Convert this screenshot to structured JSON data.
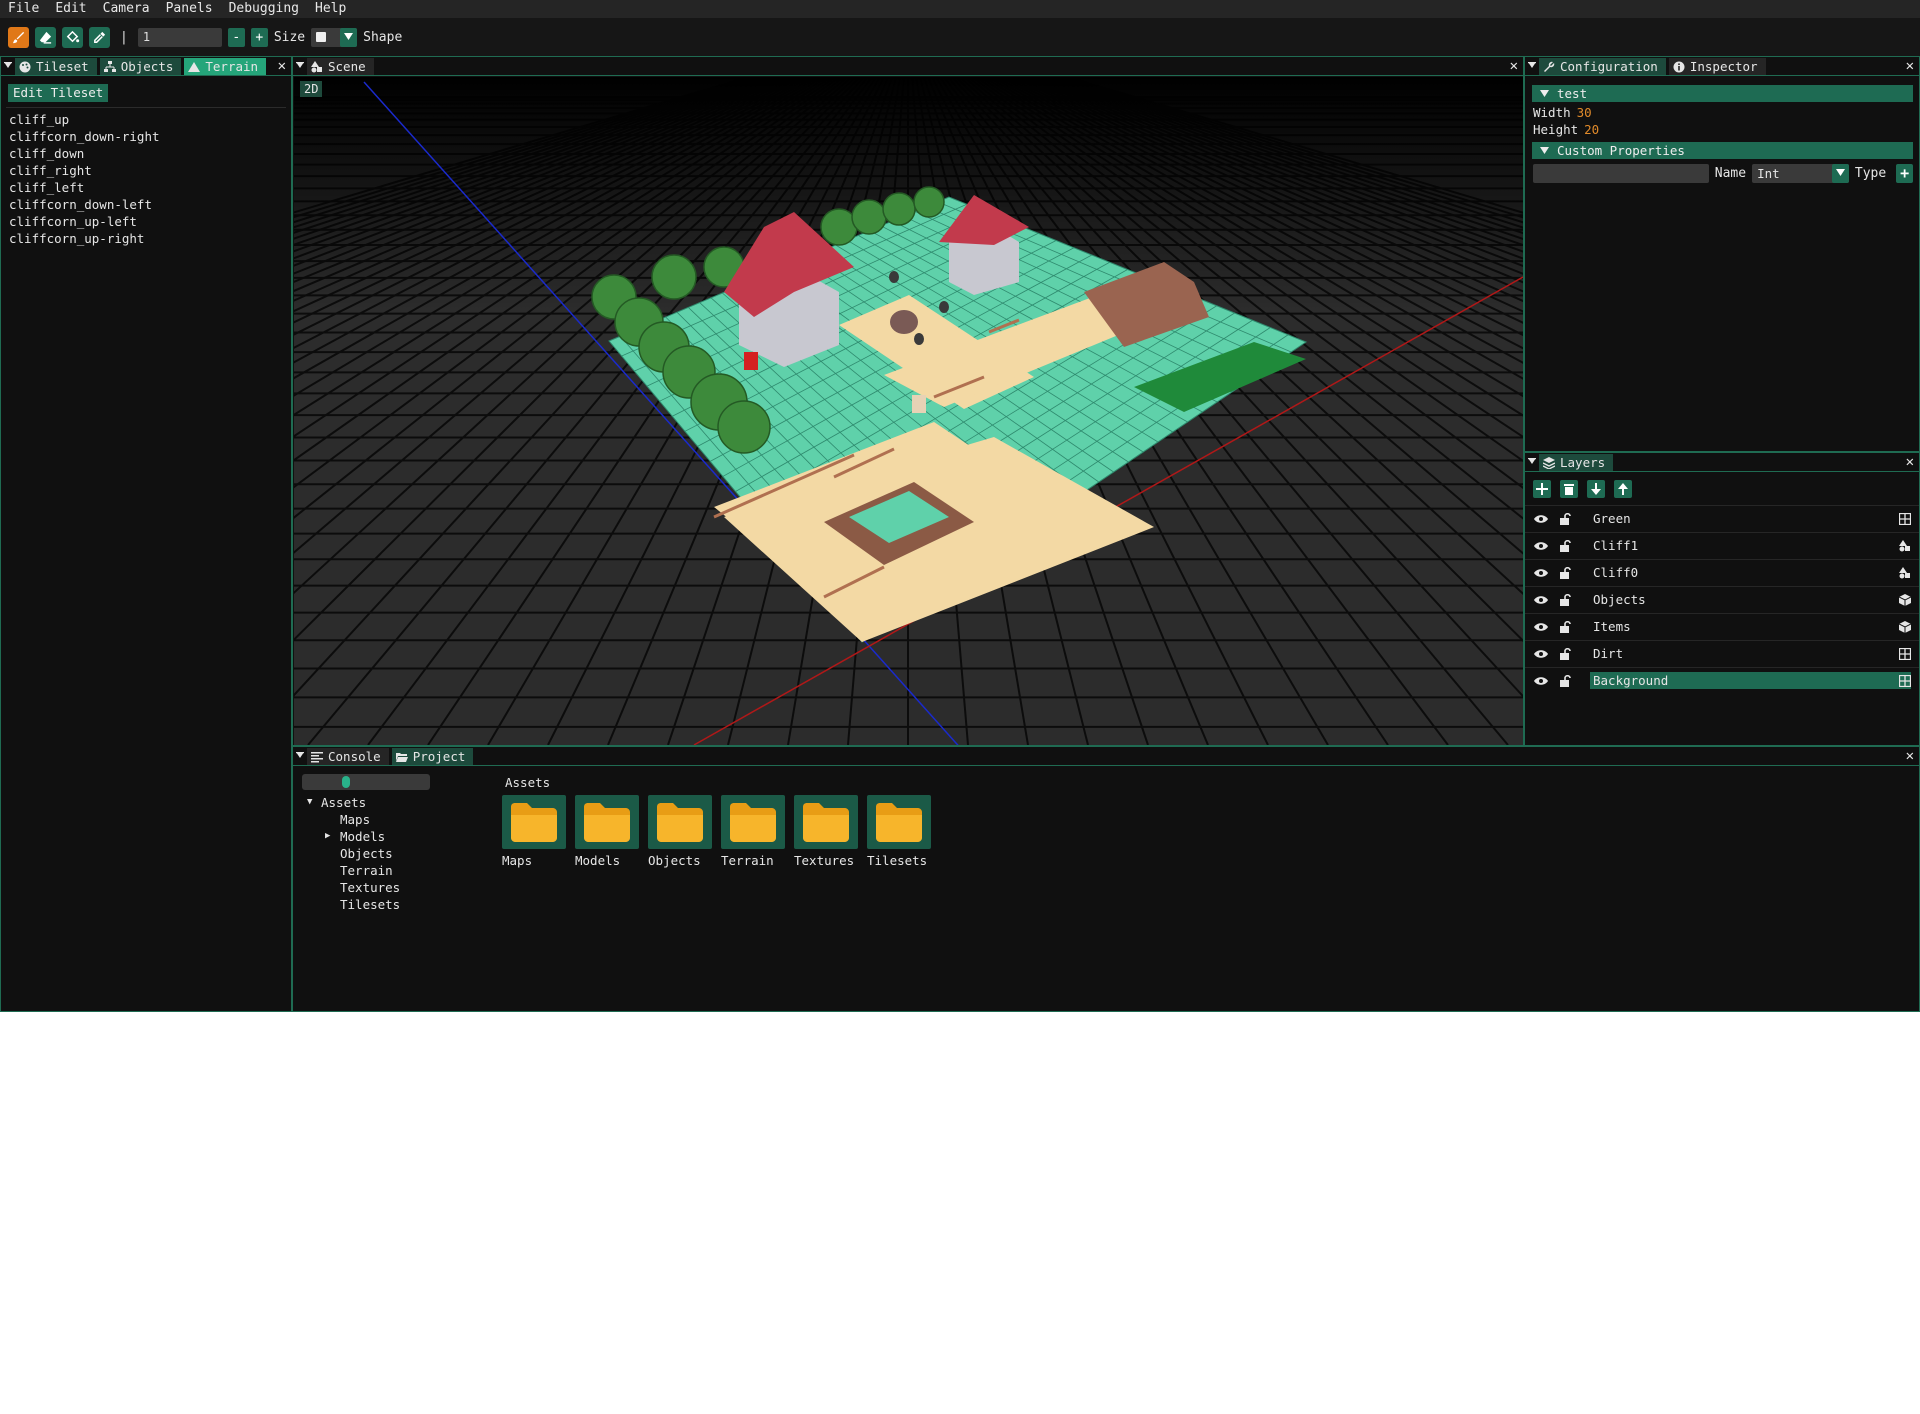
{
  "menu": [
    "File",
    "Edit",
    "Camera",
    "Panels",
    "Debugging",
    "Help"
  ],
  "toolbar": {
    "separator": "|",
    "brush_size_value": "1",
    "minus_label": "-",
    "plus_label": "+",
    "size_label": "Size",
    "shape_label": "Shape"
  },
  "left_panel": {
    "tabs": [
      "Tileset",
      "Objects",
      "Terrain"
    ],
    "active_tab": "Terrain",
    "edit_button": "Edit Tileset",
    "tiles": [
      "cliff_up",
      "cliffcorn_down-right",
      "cliff_down",
      "cliff_right",
      "cliff_left",
      "cliffcorn_down-left",
      "cliffcorn_up-left",
      "cliffcorn_up-right"
    ]
  },
  "scene": {
    "tab": "Scene",
    "mode_button": "2D"
  },
  "config_panel": {
    "tabs": [
      "Configuration",
      "Inspector"
    ],
    "map_name": "test",
    "width_label": "Width",
    "width_value": "30",
    "height_label": "Height",
    "height_value": "20",
    "custom_properties_label": "Custom Properties",
    "name_label": "Name",
    "type_value": "Int",
    "type_label": "Type"
  },
  "layers_panel": {
    "tab": "Layers",
    "layers": [
      {
        "name": "Green",
        "kind": "grid-icon"
      },
      {
        "name": "Cliff1",
        "kind": "terrain-icon"
      },
      {
        "name": "Cliff0",
        "kind": "terrain-icon"
      },
      {
        "name": "Objects",
        "kind": "cube-icon"
      },
      {
        "name": "Items",
        "kind": "cube-icon"
      },
      {
        "name": "Dirt",
        "kind": "grid-icon"
      },
      {
        "name": "Background",
        "kind": "grid-icon"
      }
    ],
    "selected": "Background"
  },
  "bottom_panel": {
    "tabs": [
      "Console",
      "Project"
    ],
    "active_tab": "Project",
    "tree": {
      "root": "Assets",
      "children": [
        "Maps",
        "Models",
        "Objects",
        "Terrain",
        "Textures",
        "Tilesets"
      ]
    },
    "path": "Assets",
    "folders": [
      "Maps",
      "Models",
      "Objects",
      "Terrain",
      "Textures",
      "Tilesets"
    ],
    "thumbnail_scale": 0.33
  },
  "colors": {
    "accent": "#1e6b53",
    "tab_active": "#25a57a",
    "brush_active": "#e07818",
    "number": "#e08a2a",
    "folder": "#f7b52b"
  }
}
